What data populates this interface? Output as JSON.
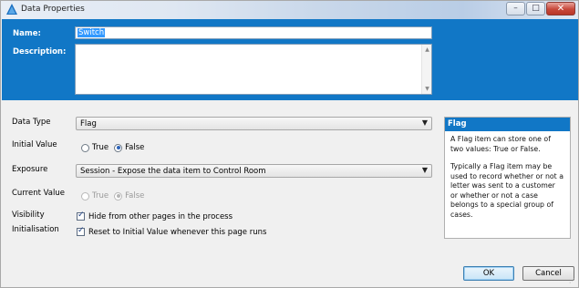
{
  "window": {
    "title": "Data Properties",
    "controls": {
      "minimize": "–",
      "maximize": "□",
      "close": "✕"
    }
  },
  "header": {
    "name_label": "Name:",
    "name_value": "Switch",
    "description_label": "Description:",
    "description_value": ""
  },
  "form": {
    "data_type_label": "Data Type",
    "data_type_value": "Flag",
    "initial_value_label": "Initial Value",
    "initial_value_options": [
      {
        "label": "True",
        "selected": false
      },
      {
        "label": "False",
        "selected": true
      }
    ],
    "exposure_label": "Exposure",
    "exposure_value": "Session - Expose the data item to Control Room",
    "current_value_label": "Current Value",
    "current_value_options": [
      {
        "label": "True",
        "selected": false
      },
      {
        "label": "False",
        "selected": true
      }
    ],
    "visibility_label": "Visibility",
    "visibility_checkbox": "Hide from other pages in the process",
    "initialisation_label": "Initialisation",
    "initialisation_checkbox": "Reset to Initial Value whenever this page runs"
  },
  "help": {
    "title": "Flag",
    "paragraph1": "A Flag item can store one of two values: True or False.",
    "paragraph2": "Typically a Flag item may be used to record whether or not a letter was sent to a customer or whether or not a case belongs to a special group of cases."
  },
  "buttons": {
    "ok": "OK",
    "cancel": "Cancel"
  },
  "colors": {
    "header_blue": "#1177c6",
    "selection": "#3399ff"
  }
}
